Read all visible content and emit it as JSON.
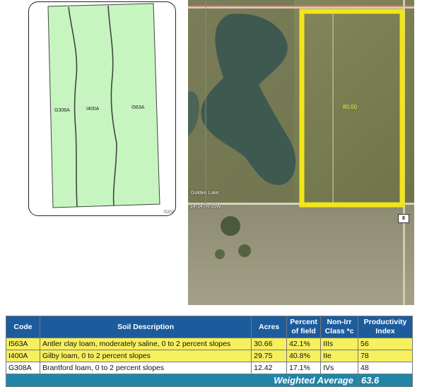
{
  "soil_map": {
    "labels": {
      "g308a": "G308A",
      "i400a": "I400A",
      "i563a": "I563A"
    },
    "copyright": "©202",
    "fill_color": "#c7f5c0"
  },
  "aerial": {
    "place_label": "Golden Lake",
    "section_label": "14-147N-55W",
    "acres_label": "80.00",
    "road_shield": "8",
    "highlight_color": "#f2e51c"
  },
  "table": {
    "headers": {
      "code": "Code",
      "description": "Soil Description",
      "acres": "Acres",
      "percent": "Percent of field",
      "class": "Non-Irr Class *c",
      "productivity": "Productivity Index"
    },
    "rows": [
      {
        "code": "I563A",
        "description": "Antler clay loam, moderately saline, 0 to 2 percent slopes",
        "acres": "30.66",
        "percent": "42.1%",
        "class": "IIIs",
        "productivity": "56"
      },
      {
        "code": "I400A",
        "description": "Gilby loam, 0 to 2 percent slopes",
        "acres": "29.75",
        "percent": "40.8%",
        "class": "IIe",
        "productivity": "78"
      },
      {
        "code": "G308A",
        "description": "Brantford loam, 0 to 2 percent slopes",
        "acres": "12.42",
        "percent": "17.1%",
        "class": "IVs",
        "productivity": "48"
      }
    ],
    "weighted_label": "Weighted Average",
    "weighted_value": "63.6"
  }
}
